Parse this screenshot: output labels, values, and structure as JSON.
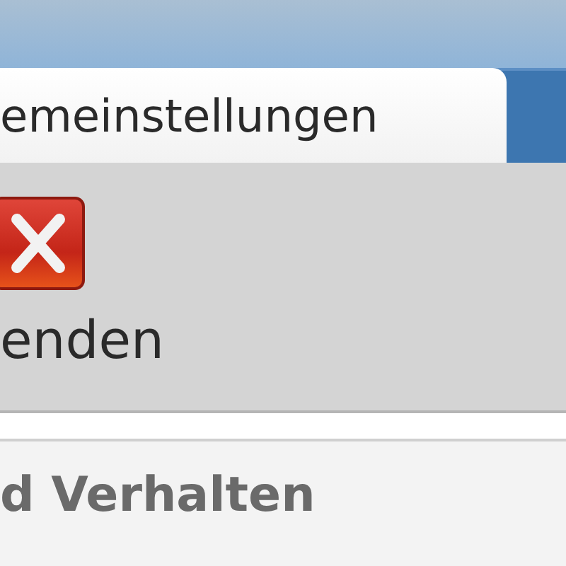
{
  "tabs": [
    {
      "label": "emeinstellungen",
      "selected": true
    }
  ],
  "toolbar": {
    "buttons": [
      {
        "kind": "close",
        "label": "enden"
      }
    ]
  },
  "section": {
    "heading": "d Verhalten"
  }
}
